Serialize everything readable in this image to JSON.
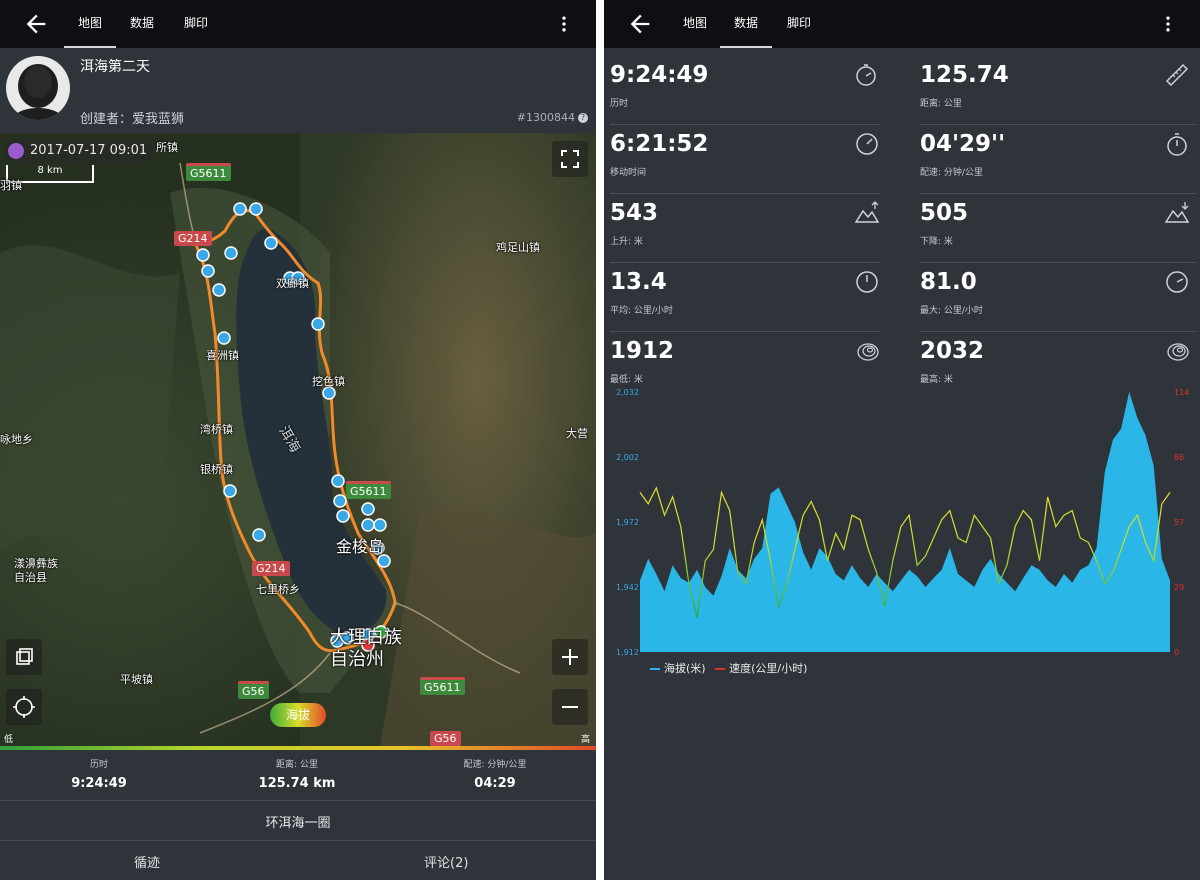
{
  "colors": {
    "accent": "#2bb6e8",
    "route": "#f08a2a",
    "speed": "#e0302a",
    "elevation": "#2bb6e8"
  },
  "left": {
    "tabs": [
      "地图",
      "数据",
      "脚印"
    ],
    "title": "洱海第二天",
    "creator": "创建者：爱我蓝狮",
    "route_id": "#1300844",
    "map": {
      "date": "2017-07-17 09:01",
      "scale": "8 km",
      "labels": [
        "所镇",
        "羽镇",
        "鸡足山镇",
        "双廊镇",
        "喜洲镇",
        "挖色镇",
        "湾桥镇",
        "银桥镇",
        "洱海",
        "大营",
        "金梭岛",
        "七里桥乡",
        "漾濞彝族\n自治县",
        "大理白族\n自治州",
        "平坡镇",
        "咏地乡"
      ],
      "shields": [
        "G5611",
        "G214",
        "G5611",
        "G214",
        "G56",
        "G5611",
        "G56"
      ],
      "elevation_button": "海拔",
      "gradient_low": "低",
      "gradient_high": "高"
    },
    "stats": [
      {
        "label": "历时",
        "value": "9:24:49"
      },
      {
        "label": "距离: 公里",
        "value": "125.74 km"
      },
      {
        "label": "配速: 分钟/公里",
        "value": "04:29"
      }
    ],
    "route_name": "环洱海一圈",
    "buttons": [
      "循迹",
      "评论(2)"
    ]
  },
  "right": {
    "tabs": [
      "地图",
      "数据",
      "脚印"
    ],
    "metrics": [
      {
        "value": "9:24:49",
        "label": "历时",
        "icon": "stopwatch-icon"
      },
      {
        "value": "125.74",
        "label": "距离: 公里",
        "icon": "ruler-icon"
      },
      {
        "value": "6:21:52",
        "label": "移动时间",
        "icon": "speedometer-icon"
      },
      {
        "value": "04'29''",
        "label": "配速: 分钟/公里",
        "icon": "timer-icon"
      },
      {
        "value": "543",
        "label": "上升: 米",
        "icon": "ascent-icon"
      },
      {
        "value": "505",
        "label": "下降: 米",
        "icon": "descent-icon"
      },
      {
        "value": "13.4",
        "label": "平均: 公里/小时",
        "icon": "speedometer-icon"
      },
      {
        "value": "81.0",
        "label": "最大: 公里/小时",
        "icon": "speedometer-icon"
      },
      {
        "value": "1912",
        "label": "最低: 米",
        "icon": "terrain-icon"
      },
      {
        "value": "2032",
        "label": "最高: 米",
        "icon": "terrain-icon"
      }
    ]
  },
  "chart_data": {
    "type": "area",
    "x_count": 66,
    "series": [
      {
        "name": "海拔(米)",
        "axis": "left",
        "values": [
          1945,
          1955,
          1948,
          1940,
          1952,
          1946,
          1944,
          1950,
          1942,
          1938,
          1947,
          1960,
          1950,
          1946,
          1955,
          1960,
          1985,
          1988,
          1980,
          1972,
          1958,
          1950,
          1960,
          1956,
          1948,
          1945,
          1952,
          1946,
          1942,
          1948,
          1944,
          1940,
          1945,
          1950,
          1947,
          1942,
          1946,
          1950,
          1960,
          1948,
          1945,
          1942,
          1950,
          1955,
          1948,
          1944,
          1940,
          1946,
          1952,
          1950,
          1945,
          1942,
          1948,
          1944,
          1950,
          1952,
          1960,
          1995,
          2010,
          2015,
          2032,
          2020,
          2012,
          1998,
          1955,
          1945
        ]
      },
      {
        "name": "速度(公里/小时)",
        "axis": "right",
        "values": [
          70,
          65,
          72,
          60,
          68,
          55,
          30,
          15,
          40,
          45,
          70,
          62,
          35,
          30,
          48,
          58,
          40,
          20,
          30,
          45,
          60,
          66,
          58,
          40,
          52,
          45,
          60,
          58,
          45,
          35,
          20,
          40,
          55,
          60,
          38,
          42,
          50,
          58,
          62,
          50,
          48,
          60,
          55,
          50,
          30,
          38,
          55,
          62,
          58,
          40,
          68,
          55,
          60,
          62,
          50,
          48,
          40,
          30,
          35,
          45,
          55,
          60,
          48,
          40,
          65,
          70
        ]
      }
    ],
    "y_left": {
      "ticks": [
        "1,912",
        "1,942",
        "1,972",
        "2,002",
        "2,032"
      ],
      "ylim": [
        1912,
        2032
      ]
    },
    "y_right": {
      "ticks": [
        "0",
        "29",
        "57",
        "86",
        "114"
      ],
      "ylim": [
        0,
        114
      ]
    },
    "legend": [
      "海拔(米)",
      "速度(公里/小时)"
    ]
  }
}
